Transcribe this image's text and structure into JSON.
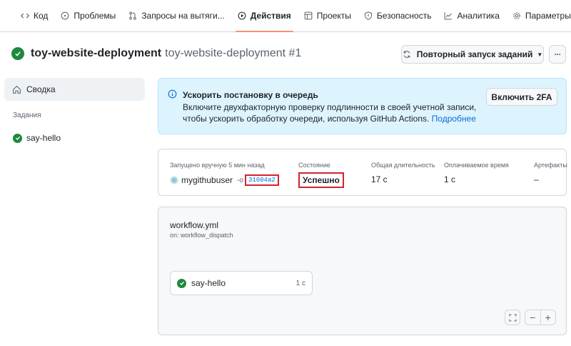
{
  "nav": {
    "items": [
      {
        "label": "Код",
        "icon": "code-icon"
      },
      {
        "label": "Проблемы",
        "icon": "issue-icon"
      },
      {
        "label": "Запросы на вытяги...",
        "icon": "pull-request-icon"
      },
      {
        "label": "Действия",
        "icon": "play-icon",
        "active": true
      },
      {
        "label": "Проекты",
        "icon": "table-icon"
      },
      {
        "label": "Безопасность",
        "icon": "shield-icon"
      },
      {
        "label": "Аналитика",
        "icon": "graph-icon"
      },
      {
        "label": "Параметры",
        "icon": "gear-icon"
      }
    ]
  },
  "header": {
    "workflow_name": "toy-website-deployment",
    "run_title": "toy-website-deployment #1",
    "rerun_label": "Повторный запуск заданий",
    "more_label": "···"
  },
  "sidebar": {
    "summary_label": "Сводка",
    "jobs_heading": "Задания",
    "jobs": [
      {
        "label": "say-hello"
      }
    ]
  },
  "banner": {
    "title": "Ускорить постановку в очередь",
    "text": "Включите двухфакторную проверку подлинности в своей учетной записи, чтобы ускорить обработку очереди, используя GitHub Actions.",
    "link": "Подробнее",
    "button": "Включить 2FA"
  },
  "summary": {
    "triggered_label": "Запущено вручную 5 мин назад",
    "user": "mygithubuser",
    "sha": "31604a2",
    "status_label": "Состояние",
    "status_value": "Успешно",
    "duration_label": "Общая длительность",
    "duration_value": "17 с",
    "billable_label": "Оплачиваемое время",
    "billable_value": "1 с",
    "artifacts_label": "Артефакты",
    "artifacts_value": "–"
  },
  "workflow": {
    "file": "workflow.yml",
    "trigger": "on: workflow_dispatch",
    "job_name": "say-hello",
    "job_duration": "1 с"
  },
  "colors": {
    "success": "#1f883d",
    "highlight": "#d1242f",
    "link": "#0969da",
    "banner_bg": "#ddf4ff",
    "active_tab": "#fd8c73"
  }
}
